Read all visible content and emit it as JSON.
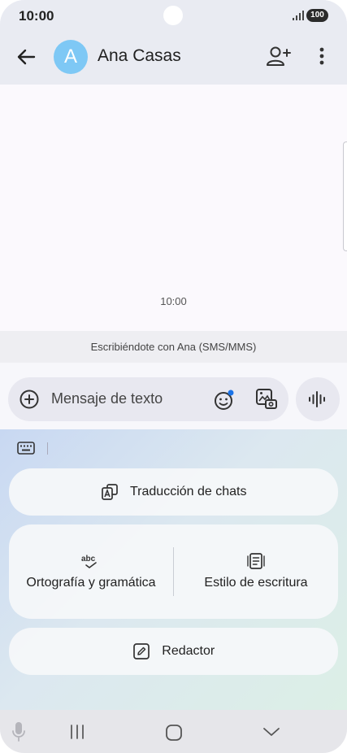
{
  "status_bar": {
    "time": "10:00",
    "battery": "100"
  },
  "header": {
    "avatar_letter": "A",
    "contact_name": "Ana Casas"
  },
  "conversation": {
    "timestamp": "10:00",
    "info": "Escribiéndote con Ana (SMS/MMS)"
  },
  "compose": {
    "placeholder": "Mensaje de texto"
  },
  "ai_panel": {
    "translate_label": "Traducción de chats",
    "spelling_label": "Ortografía y gramática",
    "style_label": "Estilo de escritura",
    "composer_label": "Redactor"
  },
  "colors": {
    "avatar": "#7ec8f5",
    "header_bg": "#e9ebf2",
    "compose_bg": "#e8e8f0",
    "accent_dot": "#1a73e8"
  },
  "icons": [
    "back-arrow-icon",
    "add-person-icon",
    "more-vert-icon",
    "add-circle-icon",
    "emoji-icon",
    "gallery-icon",
    "voice-waveform-icon",
    "keyboard-icon",
    "translate-icon",
    "spell-check-icon",
    "writing-style-icon",
    "compose-edit-icon",
    "mic-icon",
    "recent-apps-icon",
    "home-icon",
    "nav-back-icon"
  ]
}
